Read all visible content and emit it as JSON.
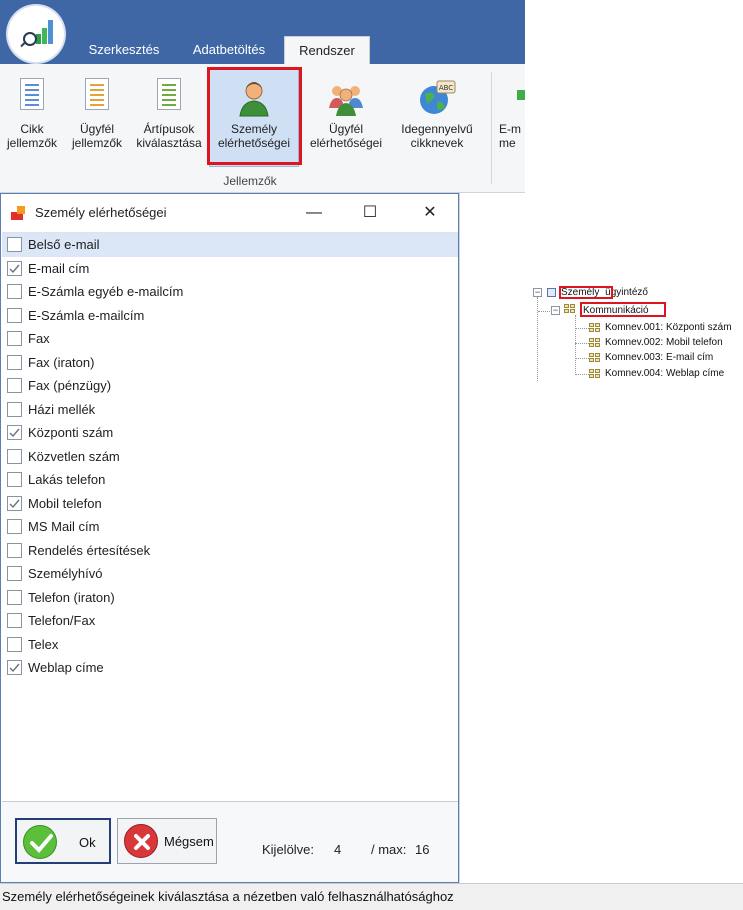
{
  "ribbon": {
    "tabs": [
      "Szerkesztés",
      "Adatbetöltés",
      "Rendszer"
    ],
    "active_tab": "Rendszer",
    "buttons": [
      {
        "label": "Cikk\njellemzők",
        "icon": "document-list-icon"
      },
      {
        "label": "Ügyfél\njellemzők",
        "icon": "document-list-orange-icon"
      },
      {
        "label": "Ártípusok\nkiválasztása",
        "icon": "document-list-green-icon"
      },
      {
        "label": "Személy\nelérhetőségei",
        "icon": "person-icon"
      },
      {
        "label": "Ügyfél\nelérhetőségei",
        "icon": "group-icon"
      },
      {
        "label": "Idegennyelvű\ncikknevek",
        "icon": "globe-abc-icon"
      },
      {
        "label": "E-m\nme",
        "icon": "mail-icon"
      }
    ],
    "group_label": "Jellemzők"
  },
  "dialog": {
    "title": "Személy elérhetőségei",
    "controls": {
      "minimize": "—",
      "maximize": "☐",
      "close": "✕"
    },
    "items": [
      {
        "label": "Belső e-mail",
        "checked": false
      },
      {
        "label": "E-mail cím",
        "checked": true
      },
      {
        "label": "E-Számla egyéb e-mailcím",
        "checked": false
      },
      {
        "label": "E-Számla e-mailcím",
        "checked": false
      },
      {
        "label": "Fax",
        "checked": false
      },
      {
        "label": "Fax (iraton)",
        "checked": false
      },
      {
        "label": "Fax (pénzügy)",
        "checked": false
      },
      {
        "label": "Házi mellék",
        "checked": false
      },
      {
        "label": "Központi szám",
        "checked": true
      },
      {
        "label": "Közvetlen szám",
        "checked": false
      },
      {
        "label": "Lakás telefon",
        "checked": false
      },
      {
        "label": "Mobil telefon",
        "checked": true
      },
      {
        "label": "MS Mail cím",
        "checked": false
      },
      {
        "label": "Rendelés értesítések",
        "checked": false
      },
      {
        "label": "Személyhívó",
        "checked": false
      },
      {
        "label": "Telefon (iraton)",
        "checked": false
      },
      {
        "label": "Telefon/Fax",
        "checked": false
      },
      {
        "label": "Telex",
        "checked": false
      },
      {
        "label": "Weblap címe",
        "checked": true
      }
    ],
    "ok_label": "Ok",
    "cancel_label": "Mégsem",
    "selected_label": "Kijelölve:",
    "selected_count": "4",
    "max_label": "/ max:",
    "max_count": "16"
  },
  "status_bar": "Személy elérhetőségeinek kiválasztása a nézetben való felhasználhatósághoz",
  "tree": {
    "root": "Személy",
    "root_suffix": "ügyintéző",
    "child": "Kommunikáció",
    "leaves": [
      "Komnev.001: Központi szám",
      "Komnev.002: Mobil telefon",
      "Komnev.003: E-mail cím",
      "Komnev.004: Weblap címe"
    ]
  },
  "colors": {
    "ribbon_blue": "#3f67a5",
    "highlight": "#e0141e",
    "selected_row": "#dbe6f6"
  }
}
